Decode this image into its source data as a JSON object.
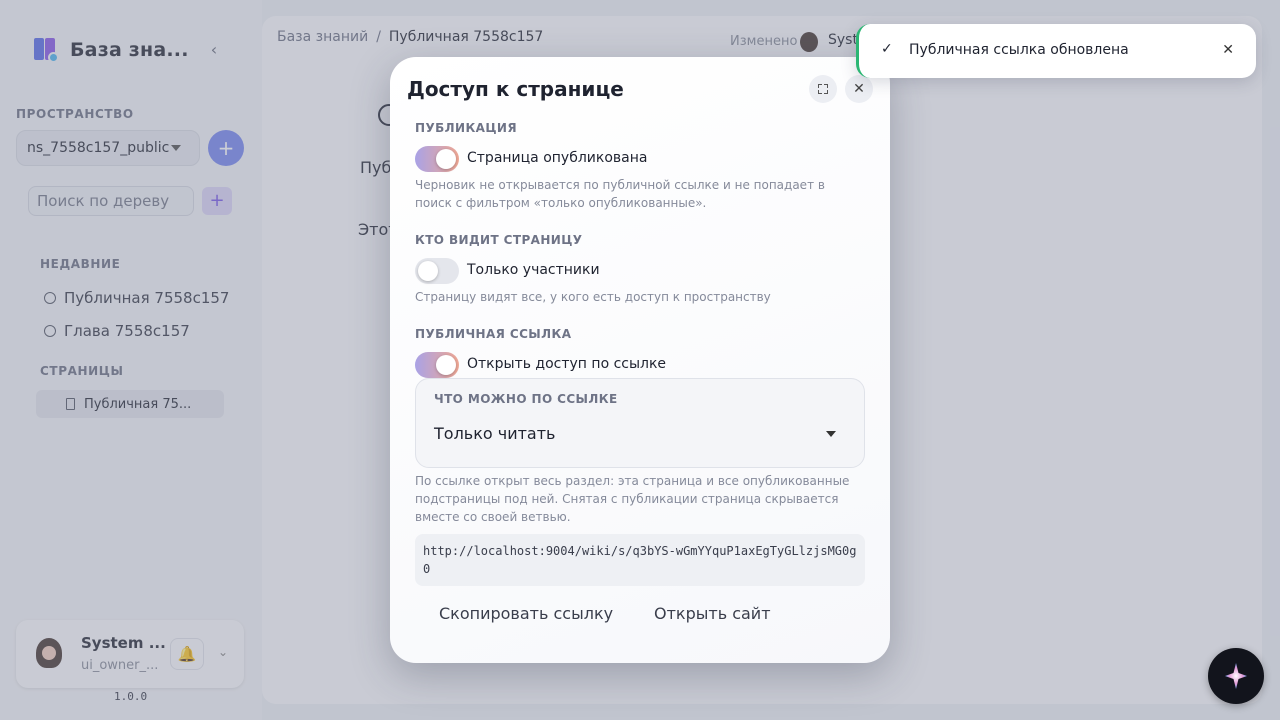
{
  "sidebar": {
    "brand_title": "База зна...",
    "space_label": "ПРОСТРАНСТВО",
    "space_value": "ns_7558c157_public",
    "tree_search_placeholder": "Поиск по дереву",
    "recent_label": "НЕДАВНИЕ",
    "recent": [
      "Публичная 7558c157",
      "Глава 7558c157"
    ],
    "pages_label": "СТРАНИЦЫ",
    "pages": [
      "Публичная 75..."
    ],
    "user_name": "System ...",
    "user_login": "ui_owner_...",
    "version": "1.0.0"
  },
  "header": {
    "breadcrumb_root": "База знаний",
    "breadcrumb_sep": "/",
    "breadcrumb_current": "Публичная 7558c157",
    "edited_label": "Изменено",
    "edited_user": "Syst"
  },
  "page_ghost": {
    "text1": "Публ",
    "text2": "Этот"
  },
  "modal": {
    "title": "Доступ к странице",
    "publish_label": "ПУБЛИКАЦИЯ",
    "published_toggle": "Страница опубликована",
    "published_on": true,
    "publish_hint": "Черновик не открывается по публичной ссылке и не попадает в поиск с фильтром «только опубликованные».",
    "who_label": "КТО ВИДИТ СТРАНИЦУ",
    "members_toggle": "Только участники",
    "members_only_on": false,
    "who_hint": "Страницу видят все, у кого есть доступ к пространству",
    "public_label": "ПУБЛИЧНАЯ ССЫЛКА",
    "link_toggle": "Открыть доступ по ссылке",
    "link_on": true,
    "perm_label": "ЧТО МОЖНО ПО ССЫЛКЕ",
    "perm_value": "Только читать",
    "link_hint": "По ссылке открыт весь раздел: эта страница и все опубликованные подстраницы под ней. Снятая с публикации страница скрывается вместе со своей ветвью.",
    "link_url": "http://localhost:9004/wiki/s/q3bYS-wGmYYquP1axEgTyGLlzjsMG0g0",
    "copy_button": "Скопировать ссылку",
    "open_button": "Открыть сайт"
  },
  "toast": {
    "message": "Публичная ссылка обновлена",
    "accent": "#2bb673"
  },
  "colors": {
    "toggle_on_start": "#a9a2e6",
    "toggle_on_end": "#f0a894",
    "primary": "#7a8af0"
  }
}
